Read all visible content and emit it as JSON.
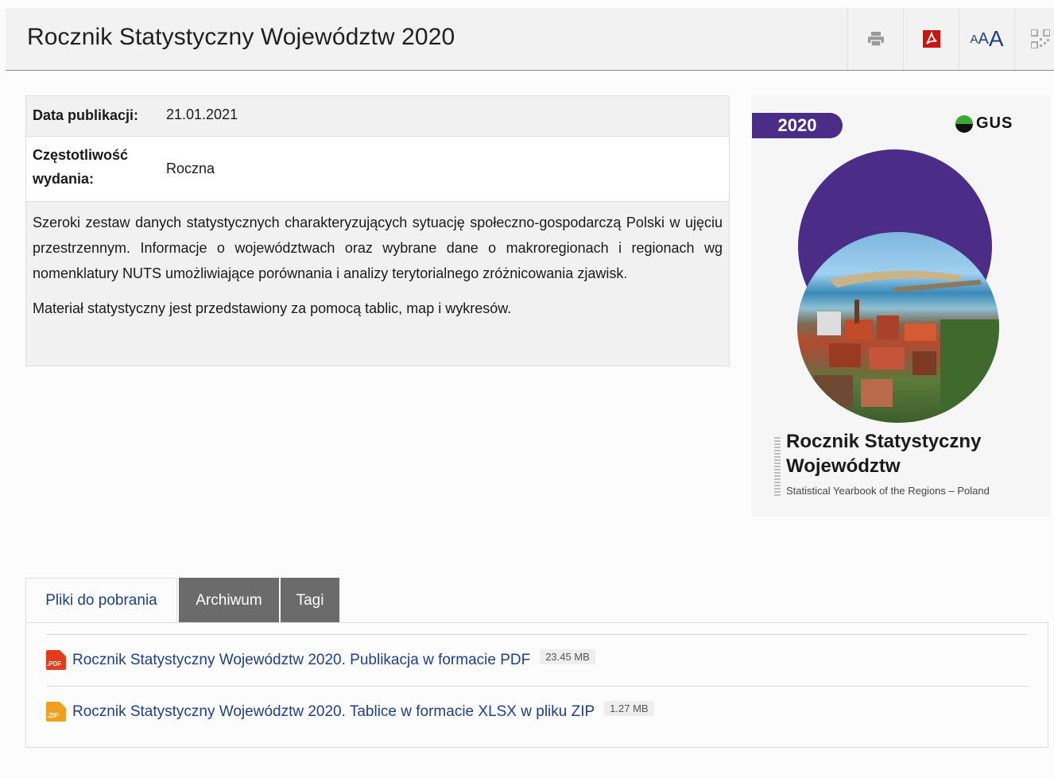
{
  "header": {
    "title": "Rocznik Statystyczny Województw 2020",
    "tools": {
      "font_small": "A",
      "font_medium": "A",
      "font_large": "A"
    }
  },
  "meta": {
    "date_label": "Data publikacji:",
    "date_value": "21.01.2021",
    "freq_label": "Częstotliwość wydania:",
    "freq_value": "Roczna"
  },
  "description": {
    "p1": "Szeroki zestaw danych statystycznych charakteryzujących sytuację społeczno-gospodarczą Polski w ujęciu przestrzennym. Informacje o województwach oraz wybrane dane o makroregionach i regionach wg nomenklatury NUTS umożliwiające porównania i analizy terytorialnego zróżnicowania zjawisk.",
    "p2": "Materiał statystyczny jest przedstawiony za pomocą tablic, map i wykresów."
  },
  "cover": {
    "year": "2020",
    "logo_text": "GUS",
    "title": "Rocznik Statystyczny Województw",
    "subtitle": "Statistical Yearbook of the Regions – Poland",
    "brand_color": "#4b2c86"
  },
  "tabs": {
    "downloads": "Pliki do pobrania",
    "archive": "Archiwum",
    "tags": "Tagi"
  },
  "files": [
    {
      "type_label": ".PDF",
      "name": "Rocznik Statystyczny Województw 2020. Publikacja w formacie PDF",
      "size": "23.45 MB",
      "icon": "pdf-file-icon"
    },
    {
      "type_label": ".ZIP",
      "name": "Rocznik Statystyczny Województw 2020. Tablice w formacie XLSX w pliku ZIP",
      "size": "1.27 MB",
      "icon": "zip-file-icon"
    }
  ],
  "colors": {
    "link": "#1c3f8f",
    "tab_inactive": "#6b6b6b",
    "pdf_red": "#e53b1d"
  }
}
